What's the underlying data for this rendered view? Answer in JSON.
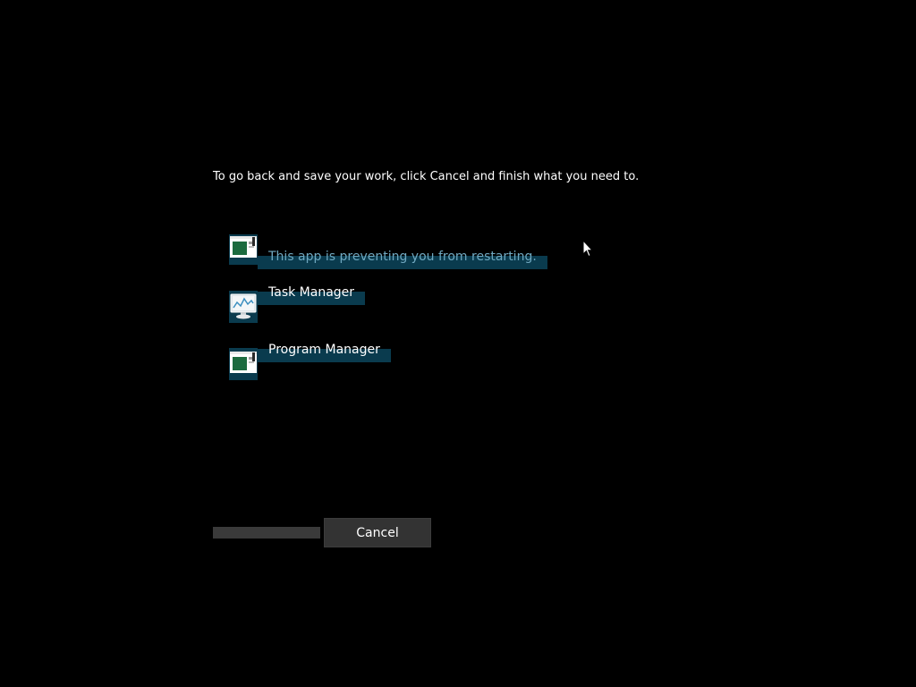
{
  "dialog": {
    "instruction": "To go back and save your work, click Cancel and finish what you need to.",
    "apps": [
      {
        "label": "This app is preventing you from restarting.",
        "icon": "app-window-icon",
        "status": "blocking"
      },
      {
        "label": "Task Manager",
        "icon": "task-manager-icon"
      },
      {
        "label": "Program Manager",
        "icon": "app-window-icon"
      }
    ],
    "cancel_label": "Cancel"
  },
  "colors": {
    "background": "#000000",
    "highlight": "#0a3b4e",
    "blocking_text": "#6fa8c0",
    "button_bg": "#333333"
  }
}
